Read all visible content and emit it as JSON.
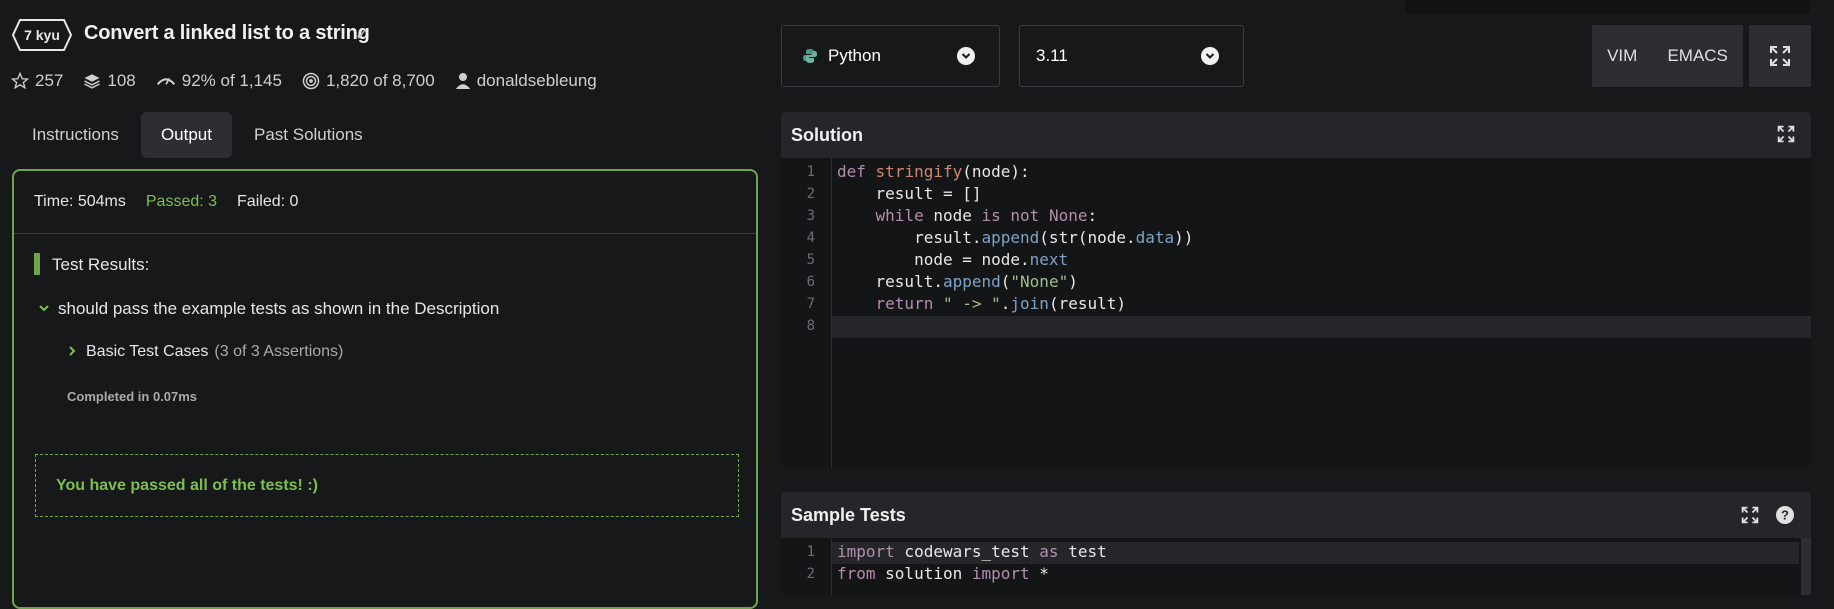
{
  "kata": {
    "rank": "7 kyu",
    "title": "Convert a linked list to a string",
    "stars": "257",
    "collections": "108",
    "satisfaction": "92%",
    "satisfaction_of": "of 1,145",
    "completed": "1,820",
    "completed_of": "of 8,700",
    "author": "donaldsebleung"
  },
  "tabs": [
    {
      "label": "Instructions",
      "active": false
    },
    {
      "label": "Output",
      "active": true
    },
    {
      "label": "Past Solutions",
      "active": false
    }
  ],
  "output": {
    "time": "Time: 504ms",
    "passed": "Passed: 3",
    "failed": "Failed: 0",
    "test_results_title": "Test Results:",
    "describe": "should pass the example tests as shown in the Description",
    "basic_label": "Basic Test Cases",
    "basic_assertions": "(3 of 3 Assertions)",
    "completed_in": "Completed in 0.07ms",
    "passed_message": "You have passed all of the tests! :)"
  },
  "language_select": {
    "value": "Python"
  },
  "version_select": {
    "value": "3.11"
  },
  "modes": {
    "vim": "VIM",
    "emacs": "EMACS"
  },
  "solution": {
    "title": "Solution",
    "line_numbers": [
      "1",
      "2",
      "3",
      "4",
      "5",
      "6",
      "7",
      "8"
    ]
  },
  "sample_tests": {
    "title": "Sample Tests",
    "line_numbers": [
      "1",
      "2"
    ]
  },
  "colors": {
    "accent_green": "#6fa54a",
    "background": "#17181a"
  }
}
